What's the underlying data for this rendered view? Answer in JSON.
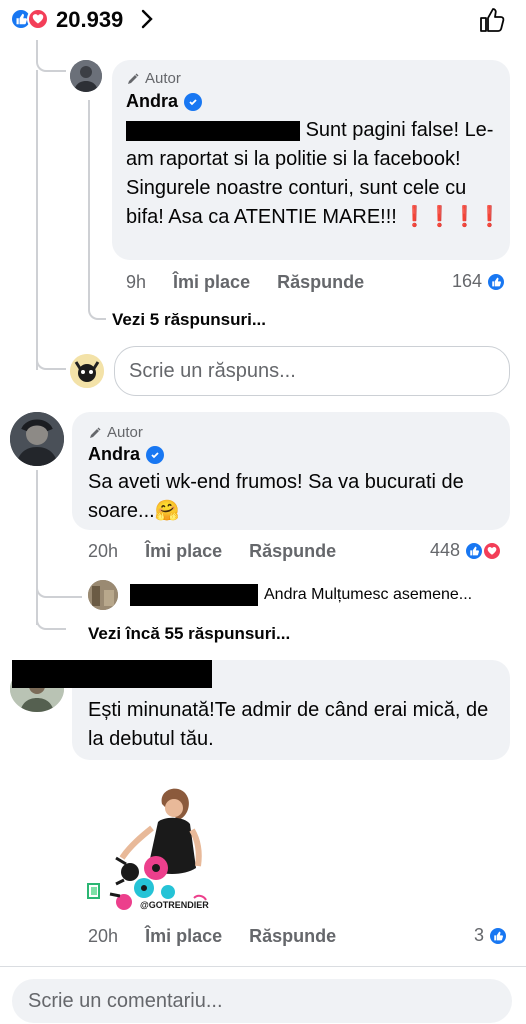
{
  "header": {
    "reaction_count": "20.939",
    "like_color": "#1877f2",
    "love_color": "#f33e58"
  },
  "comment1": {
    "author_tag": "Autor",
    "name": "Andra",
    "text_line1": "Sunt pagini false!",
    "text_rest": "Le-am raportat si la politie si la facebook! Singurele noastre conturi, sunt cele cu bifa! Asa ca ATENTIE MARE!!! ❗❗❗❗",
    "time": "9h",
    "like_label": "Îmi place",
    "reply_label": "Răspunde",
    "reaction_count": "164",
    "more_replies": "Vezi 5 răspunsuri..."
  },
  "reply_box": {
    "placeholder": "Scrie un răspuns..."
  },
  "comment2": {
    "author_tag": "Autor",
    "name": "Andra",
    "text": "Sa aveti wk-end frumos! Sa va bucurati de soare...🤗",
    "time": "20h",
    "like_label": "Îmi place",
    "reply_label": "Răspunde",
    "reaction_count": "448",
    "preview_reply": "Andra Mulțumesc asemene...",
    "more_replies": "Vezi încă 55 răspunsuri..."
  },
  "comment3": {
    "text": "Ești minunată!Te admir de când erai mică, de la debutul tău.",
    "sticker_text": "@GOTRENDIER",
    "time": "20h",
    "like_label": "Îmi place",
    "reply_label": "Răspunde",
    "reaction_count": "3"
  },
  "composer": {
    "placeholder": "Scrie un comentariu..."
  }
}
